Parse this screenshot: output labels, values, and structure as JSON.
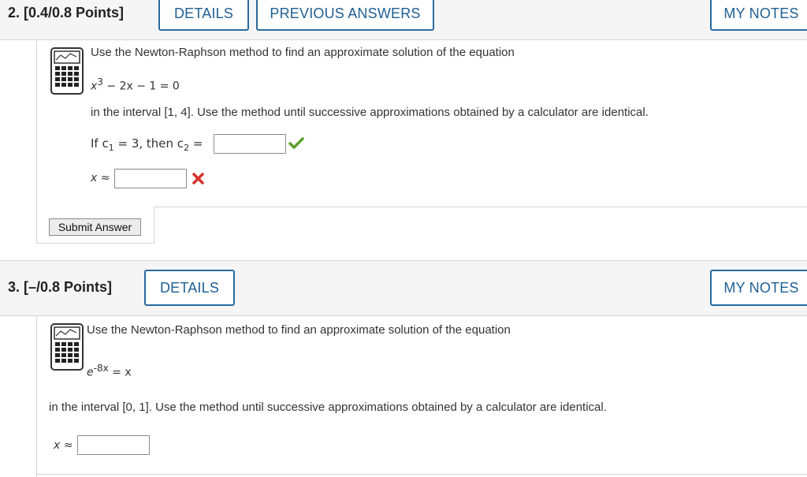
{
  "q2": {
    "points_label": "2.  [0.4/0.8 Points]",
    "details_label": "DETAILS",
    "previous_label": "PREVIOUS ANSWERS",
    "mynotes_label": "MY NOTES",
    "intro": "Use the Newton-Raphson method to find an approximate solution of the equation",
    "equation_x": "x",
    "equation_exp": "3",
    "equation_rest": " − 2x − 1 = 0",
    "instruction": "in the interval [1, 4]. Use the method until successive approximations obtained by a calculator are identical.",
    "c_prefix": "If c",
    "c1_sub": "1",
    "c_mid": " = 3, then c",
    "c2_sub": "2",
    "c_suffix": " =",
    "c2_value": "",
    "x_label": "x ≈",
    "x_value": "",
    "submit_label": "Submit Answer",
    "c2_status_color": "#5aa02c",
    "x_status_color": "#d9312b"
  },
  "q3": {
    "points_label": "3.  [–/0.8 Points]",
    "details_label": "DETAILS",
    "mynotes_label": "MY NOTES",
    "intro": "Use the Newton-Raphson method to find an approximate solution of the equation",
    "equation_base": "e",
    "equation_exp": "-8x",
    "equation_rest": " = x",
    "instruction": "in the interval [0, 1]. Use the method until successive approximations obtained by a calculator are identical.",
    "x_label": "x ≈",
    "x_value": ""
  },
  "icons": [
    "calculator-icon",
    "checkmark-icon",
    "cross-icon"
  ]
}
